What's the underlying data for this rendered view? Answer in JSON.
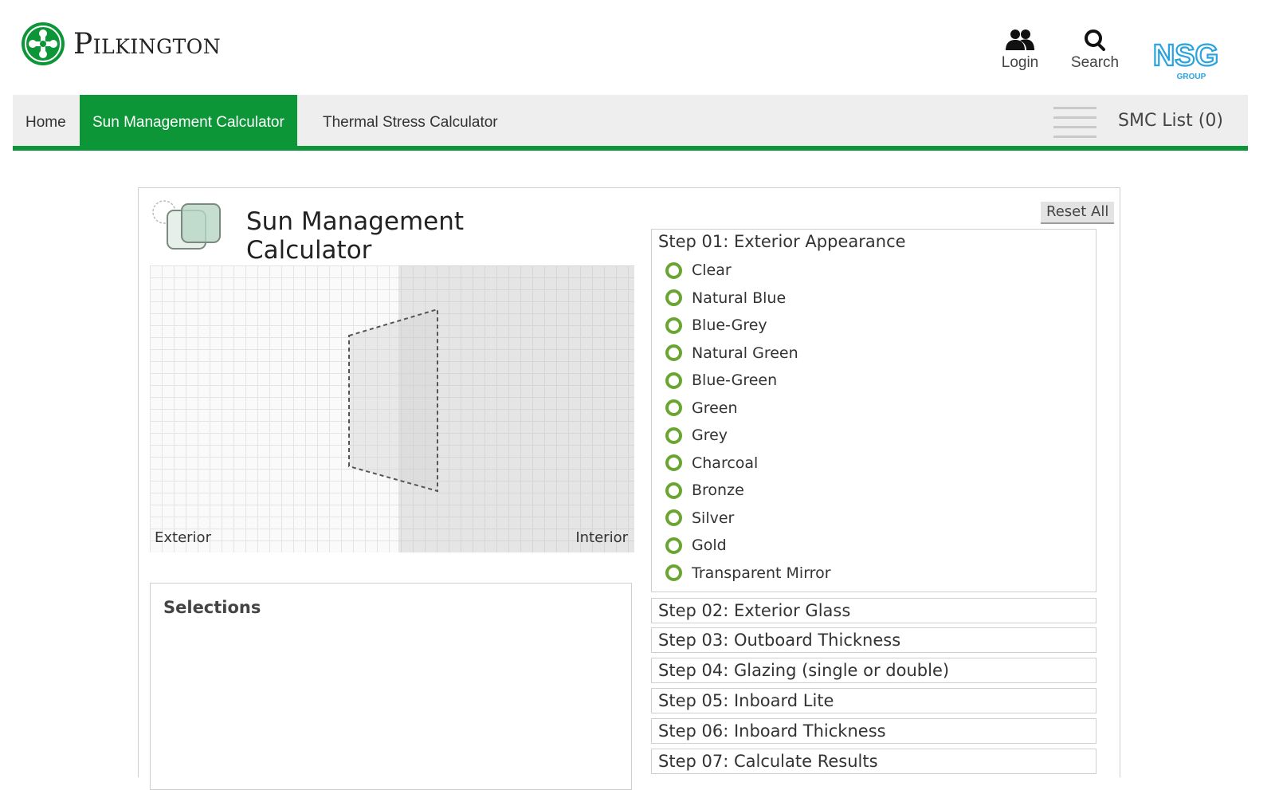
{
  "brand": {
    "name": "Pilkington",
    "partner_logo": "NSG",
    "partner_sub": "GROUP",
    "accent": "#0d9637"
  },
  "header": {
    "login_label": "Login",
    "search_label": "Search"
  },
  "nav": {
    "items": [
      {
        "label": "Home",
        "active": false
      },
      {
        "label": "Sun Management Calculator",
        "active": true
      },
      {
        "label": "Thermal Stress Calculator",
        "active": false
      }
    ],
    "menu_icon": "hamburger-icon",
    "smc_list": "SMC List (0)"
  },
  "calculator": {
    "title": "Sun Management Calculator",
    "reset_label": "Reset All",
    "diagram": {
      "exterior_label": "Exterior",
      "interior_label": "Interior"
    },
    "selections_title": "Selections",
    "steps": [
      {
        "title": "Step 01: Exterior Appearance",
        "expanded": true,
        "options": [
          "Clear",
          "Natural Blue",
          "Blue-Grey",
          "Natural Green",
          "Blue-Green",
          "Green",
          "Grey",
          "Charcoal",
          "Bronze",
          "Silver",
          "Gold",
          "Transparent Mirror"
        ]
      },
      {
        "title": "Step 02: Exterior Glass",
        "expanded": false
      },
      {
        "title": "Step 03: Outboard Thickness",
        "expanded": false
      },
      {
        "title": "Step 04: Glazing (single or double)",
        "expanded": false
      },
      {
        "title": "Step 05: Inboard Lite",
        "expanded": false
      },
      {
        "title": "Step 06: Inboard Thickness",
        "expanded": false
      },
      {
        "title": "Step 07: Calculate Results",
        "expanded": false
      }
    ]
  }
}
